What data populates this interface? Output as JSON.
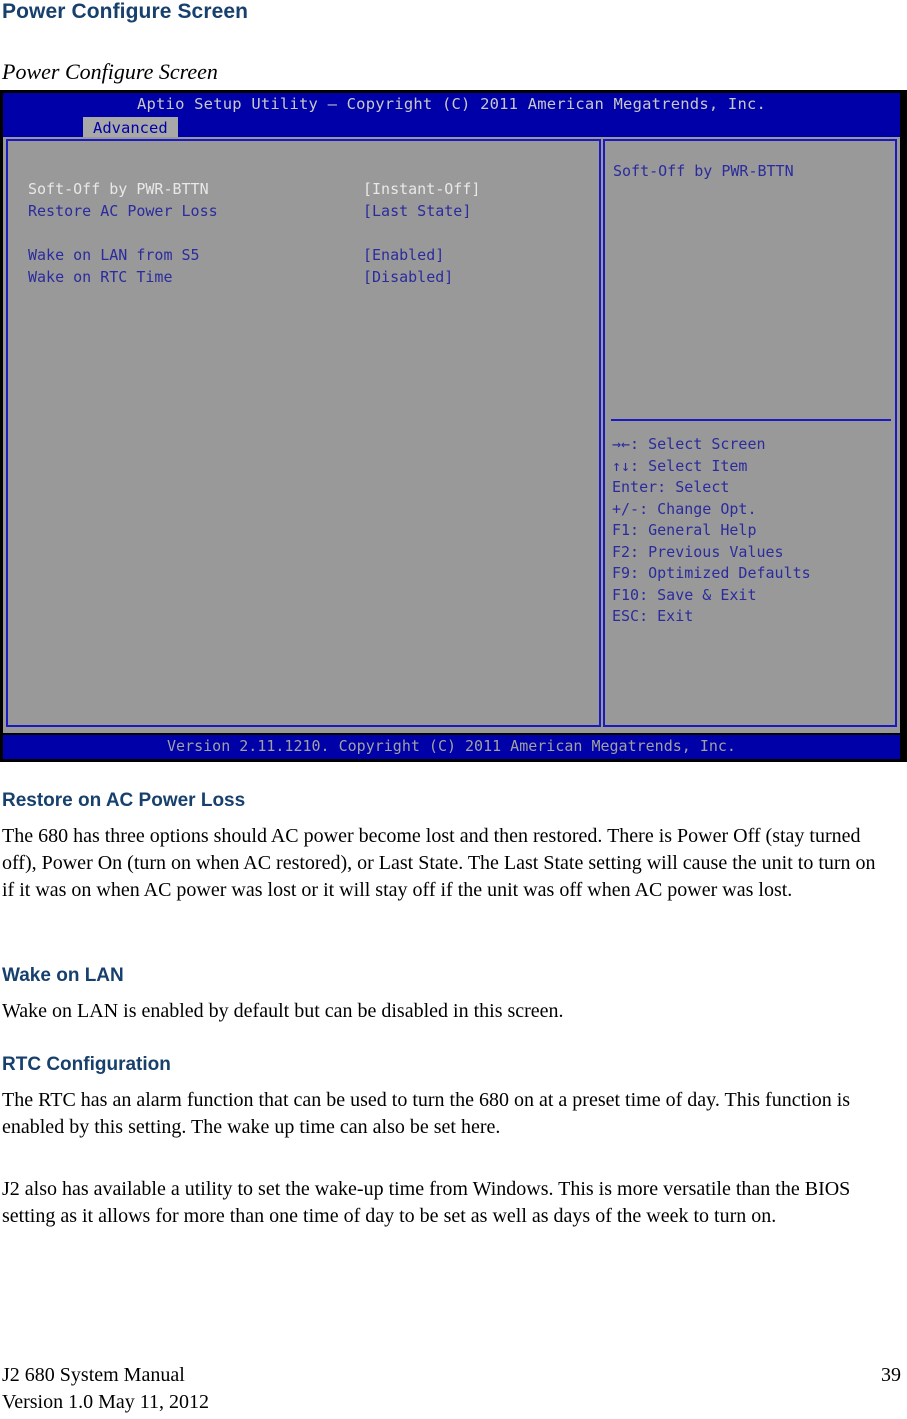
{
  "document": {
    "heading": "Power Configure Screen",
    "figure_caption": "Power Configure Screen",
    "sections": [
      {
        "heading": "Restore on AC Power Loss",
        "body": "The 680 has three options should AC power become lost and then restored. There is Power Off (stay turned off), Power On (turn on when AC restored), or Last State. The Last State setting will cause the unit to turn on if it was on when AC power was lost or it will stay off if the unit was off when AC power was lost."
      },
      {
        "heading": "Wake on LAN",
        "body": "Wake on LAN is enabled by default but can be disabled in this screen."
      },
      {
        "heading": "RTC Configuration",
        "body": "The RTC has an alarm function that can be used to turn the 680 on at a preset time of day. This function is enabled by this setting. The wake up time can also be set here."
      },
      {
        "heading": "",
        "body": "J2 also has available a utility to set the wake-up time from Windows. This is more versatile than the BIOS setting as it allows for more than one time of day to be set as well as days of the week to turn on."
      }
    ],
    "footer": {
      "manual_title": "J2 680 System Manual",
      "version_line": "Version 1.0 May 11, 2012",
      "page_number": "39"
    }
  },
  "bios": {
    "title_bar": "Aptio Setup Utility – Copyright (C) 2011 American Megatrends, Inc.",
    "active_tab": "Advanced",
    "settings": [
      {
        "label": "Soft-Off by PWR-BTTN",
        "value": "[Instant-Off]",
        "selected": true
      },
      {
        "label": "Restore AC Power Loss",
        "value": "[Last State]",
        "selected": false
      },
      {
        "label": "",
        "value": "",
        "spacer": true
      },
      {
        "label": "Wake on LAN from S5",
        "value": "[Enabled]",
        "selected": false
      },
      {
        "label": "Wake on RTC Time",
        "value": "[Disabled]",
        "selected": false
      }
    ],
    "help_title": "Soft-Off by PWR-BTTN",
    "nav_keys": [
      "→←: Select Screen",
      "↑↓: Select Item",
      "Enter: Select",
      "+/-: Change Opt.",
      "F1: General Help",
      "F2: Previous Values",
      "F9: Optimized Defaults",
      "F10: Save & Exit",
      "ESC: Exit"
    ],
    "version_bar": "Version 2.11.1210. Copyright (C) 2011 American Megatrends, Inc.",
    "colors": {
      "header_blue": "#0000a8",
      "panel_gray": "#999999",
      "border_blue": "#1a1ac0",
      "text_blue": "#2b2b9e",
      "text_highlight": "#e8e8e8"
    }
  }
}
